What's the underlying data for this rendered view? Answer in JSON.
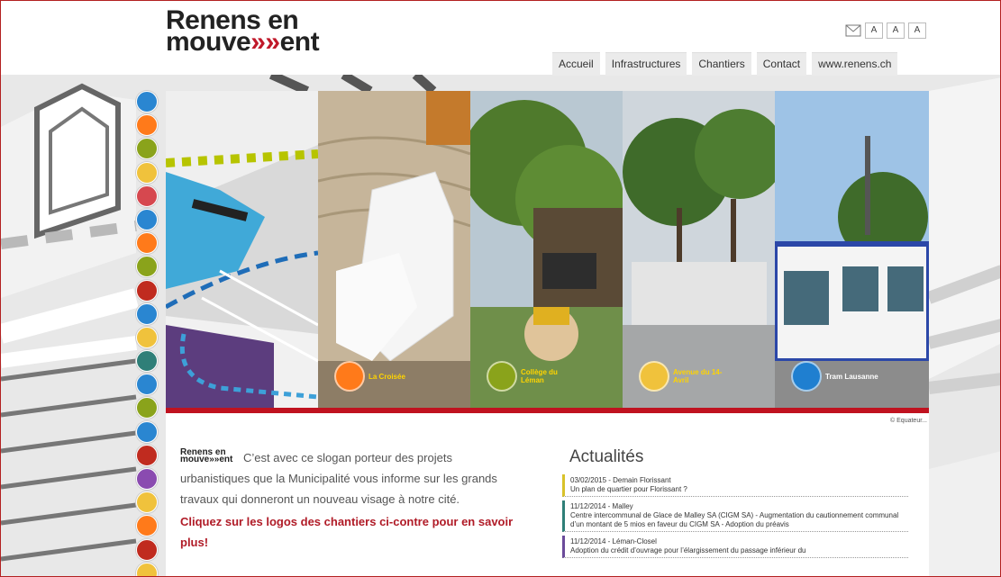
{
  "header": {
    "logo_line1": "Renens en",
    "logo_line2_a": "mouve",
    "logo_line2_b": "»»",
    "logo_line2_c": "ent",
    "tools": [
      "A",
      "A",
      "A"
    ]
  },
  "nav": {
    "tabs": [
      "Accueil",
      "Infrastructures",
      "Chantiers",
      "Contact",
      "www.renens.ch"
    ]
  },
  "banner": {
    "panels": [
      {
        "label": "La Croisée",
        "accent": "#ff7a1a"
      },
      {
        "label": "Collège du Léman",
        "accent": "#8aa31b"
      },
      {
        "label": "Avenue du 14-Avril",
        "accent": "#f0c23c"
      },
      {
        "label": "Tram Lausanne",
        "accent": "#1f7fd0"
      }
    ],
    "credit": "© Equateur..."
  },
  "intro": {
    "mini_logo_1": "Renens en",
    "mini_logo_2": "mouve»»ent",
    "text": "C’est avec ce slogan porteur des projets urbanistiques que la Municipalité vous informe sur les grands travaux qui donneront un nouveau visage à notre cité.",
    "cta": "Cliquez sur les logos des chantiers ci-contre pour en savoir plus!"
  },
  "news": {
    "title": "Actualités",
    "items": [
      {
        "head": "03/02/2015 - Demain Florissant",
        "body": "Un plan de quartier pour Florissant ?",
        "color": "#d8c22a"
      },
      {
        "head": "11/12/2014 - Malley",
        "body": "Centre intercommunal de Glace de Malley SA (CIGM SA) - Augmentation du cautionnement communal d’un montant de 5 mios en faveur du CIGM SA - Adoption du préavis",
        "color": "#2f7f78"
      },
      {
        "head": "11/12/2014 - Léman-Closel",
        "body": "Adoption du crédit d’ouvrage pour l’élargissement du passage inférieur du",
        "color": "#6b4b9a"
      }
    ]
  },
  "sidebar": {
    "icon_colors": [
      "#2a86d1",
      "#ff7a1a",
      "#8aa31b",
      "#f0c23c",
      "#d6484f",
      "#2a86d1",
      "#ff7a1a",
      "#8aa31b",
      "#c02b1f",
      "#2a86d1",
      "#f0c23c",
      "#2f7f78",
      "#2a86d1",
      "#8aa31b",
      "#2a86d1",
      "#c02b1f",
      "#8a4bb0",
      "#f0c23c",
      "#ff7a1a",
      "#c02b1f",
      "#f0c23c"
    ]
  }
}
